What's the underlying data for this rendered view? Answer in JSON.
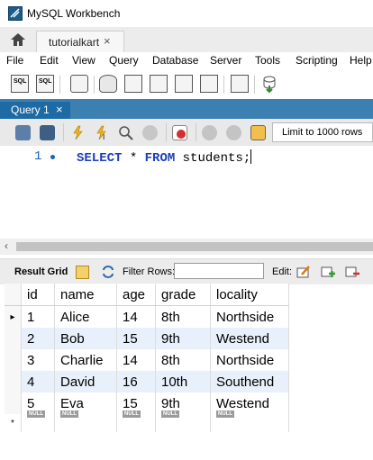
{
  "window": {
    "title": "MySQL Workbench"
  },
  "connection_tab": {
    "label": "tutorialkart",
    "close": "×"
  },
  "menu": [
    "File",
    "Edit",
    "View",
    "Query",
    "Database",
    "Server",
    "Tools",
    "Scripting",
    "Help"
  ],
  "toolbar": {
    "icons": [
      "new-sql-tab-icon",
      "open-sql-script-icon",
      "inspector-icon",
      "create-schema-icon",
      "create-table-icon",
      "create-view-icon",
      "create-procedure-icon",
      "create-function-icon",
      "search-table-data-icon",
      "reconnect-icon"
    ],
    "sql_badge": "SQL"
  },
  "query_tab": {
    "label": "Query 1",
    "close": "×"
  },
  "editor_toolbar": {
    "limit_label": "Limit to 1000 rows"
  },
  "editor": {
    "line_number": "1",
    "tokens": {
      "select": "SELECT",
      "star": " * ",
      "from": "FROM",
      "rest": " students;"
    }
  },
  "results": {
    "result_grid_label": "Result Grid",
    "filter_label": "Filter Rows:",
    "filter_value": "",
    "edit_label": "Edit:",
    "columns": [
      "id",
      "name",
      "age",
      "grade",
      "locality"
    ],
    "rows": [
      [
        "1",
        "Alice",
        "14",
        "8th",
        "Northside"
      ],
      [
        "2",
        "Bob",
        "15",
        "9th",
        "Westend"
      ],
      [
        "3",
        "Charlie",
        "14",
        "8th",
        "Northside"
      ],
      [
        "4",
        "David",
        "16",
        "10th",
        "Southend"
      ],
      [
        "5",
        "Eva",
        "15",
        "9th",
        "Westend"
      ]
    ],
    "null_label": "NULL",
    "new_row_marker": "*",
    "current_row_marker": "▸"
  }
}
